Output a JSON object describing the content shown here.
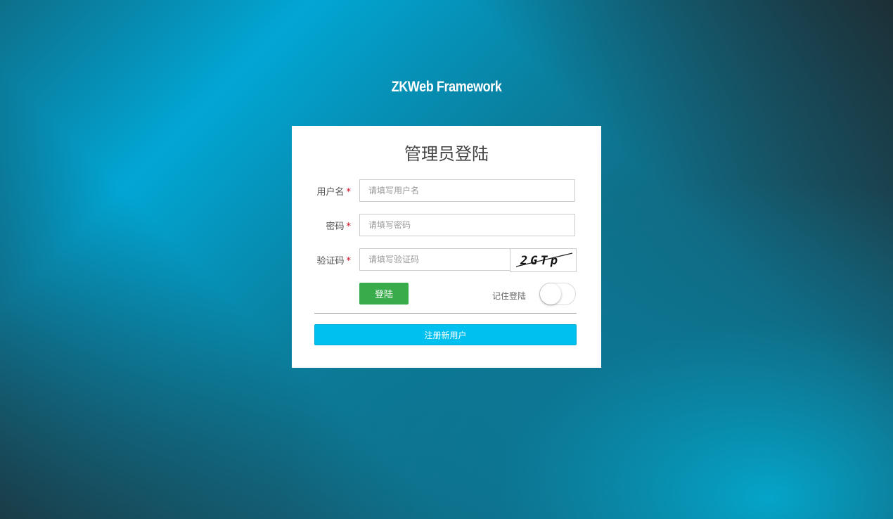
{
  "brand": "ZKWeb Framework",
  "panel": {
    "title": "管理员登陆"
  },
  "form": {
    "username": {
      "label": "用户名",
      "placeholder": "请填写用户名",
      "required_mark": "*"
    },
    "password": {
      "label": "密码",
      "placeholder": "请填写密码",
      "required_mark": "*"
    },
    "captcha": {
      "label": "验证码",
      "placeholder": "请填写验证码",
      "required_mark": "*",
      "image_text": "2GTp"
    },
    "login_button": "登陆",
    "remember_label": "记住登陆",
    "remember_on": false,
    "register_button": "注册新用户"
  },
  "colors": {
    "login_button": "#38ac4a",
    "register_button": "#00c0ef",
    "required": "#d0021b"
  }
}
